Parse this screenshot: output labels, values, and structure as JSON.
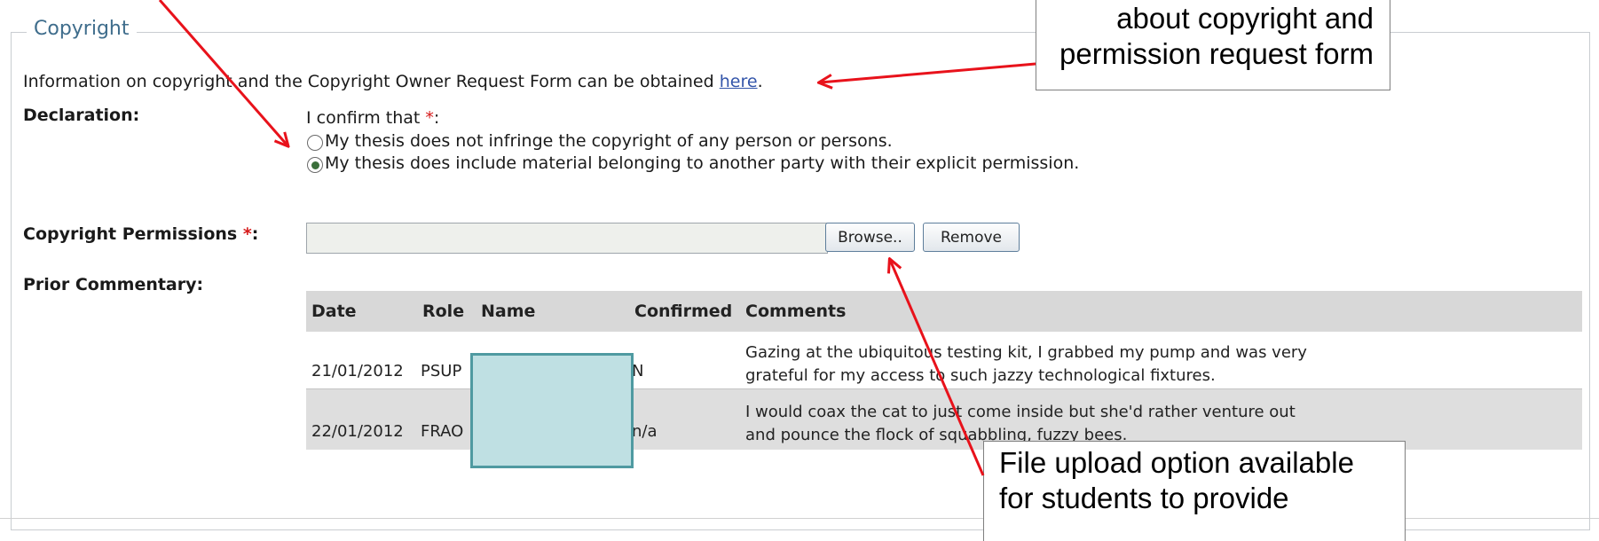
{
  "section": {
    "title": "Copyright",
    "info_text": "Information on copyright and the Copyright Owner Request Form can be obtained",
    "info_link": "here",
    "info_suffix": "."
  },
  "declaration": {
    "label": "Declaration:",
    "prompt": "I confirm that",
    "required_mark": "*",
    "prompt_suffix": ":",
    "options": [
      {
        "label": "My thesis does not infringe the copyright of any person or persons.",
        "checked": false
      },
      {
        "label": "My thesis does include material belonging to another party with their explicit permission.",
        "checked": true
      }
    ]
  },
  "permissions": {
    "label": "Copyright Permissions",
    "required_mark": "*",
    "suffix": ":",
    "file_value": "",
    "browse_label": "Browse..",
    "remove_label": "Remove"
  },
  "commentary": {
    "label": "Prior Commentary:",
    "columns": [
      "Date",
      "Role",
      "Name",
      "Confirmed",
      "Comments"
    ],
    "rows": [
      {
        "date": "21/01/2012",
        "role": "PSUP",
        "name": "",
        "confirmed": "N",
        "comment": "Gazing at the ubiquitous testing kit, I grabbed my pump and was very grateful for my access to such jazzy technological fixtures."
      },
      {
        "date": "22/01/2012",
        "role": "FRAO",
        "name": "",
        "confirmed": "n/a",
        "comment": "I would coax the cat to just come inside but she'd rather venture out and pounce the flock of squabbling, fuzzy bees."
      }
    ]
  },
  "annotations": {
    "top_callout": [
      "about copyright and",
      "permission request form"
    ],
    "bottom_callout": [
      "File upload option available",
      "for students to provide"
    ],
    "arrow_color": "#e8121b"
  }
}
